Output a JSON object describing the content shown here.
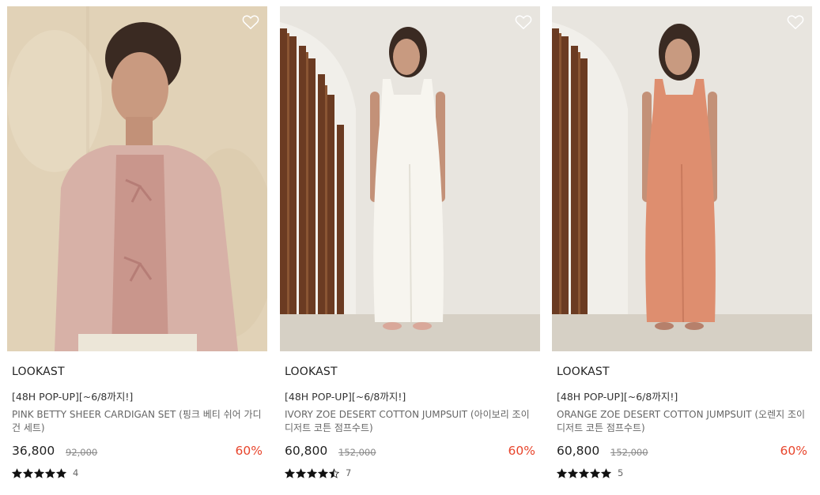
{
  "products": [
    {
      "brand": "LOOKAST",
      "promo": "[48H POP-UP][~6/8까지!]",
      "name": "PINK BETTY SHEER CARDIGAN SET (핑크 베티 쉬어 가디건 세트)",
      "price": "36,800",
      "original_price": "92,000",
      "discount": "60%",
      "rating": 5,
      "review_count": "4"
    },
    {
      "brand": "LOOKAST",
      "promo": "[48H POP-UP][~6/8까지!]",
      "name": "IVORY ZOE DESERT COTTON JUMPSUIT (아이보리 조이 디저트 코튼 점프수트)",
      "price": "60,800",
      "original_price": "152,000",
      "discount": "60%",
      "rating": 4.5,
      "review_count": "7"
    },
    {
      "brand": "LOOKAST",
      "promo": "[48H POP-UP][~6/8까지!]",
      "name": "ORANGE ZOE DESERT COTTON JUMPSUIT (오렌지 조이 디저트 코튼 점프수트)",
      "price": "60,800",
      "original_price": "152,000",
      "discount": "60%",
      "rating": 5,
      "review_count": "5"
    }
  ],
  "colors": {
    "discount": "#e8452c",
    "star": "#111111",
    "heart_outline": "#ffffff"
  },
  "icons": {
    "wishlist": "heart-outline-icon",
    "rating": "star-icon"
  }
}
